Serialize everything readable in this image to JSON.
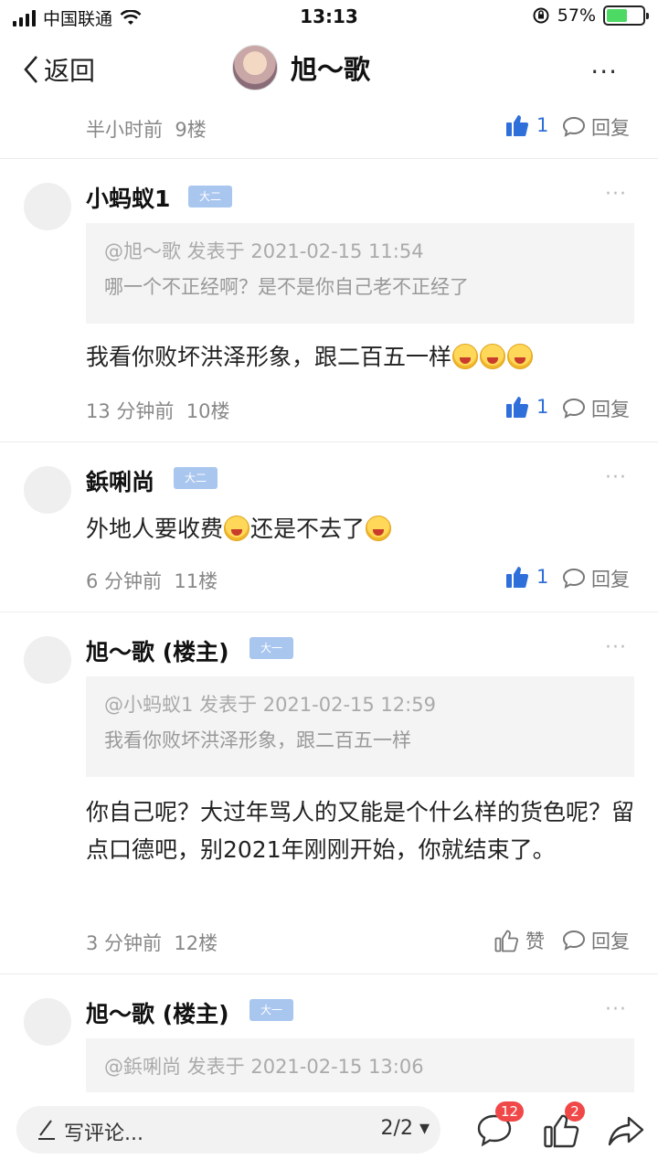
{
  "status_bar": {
    "carrier": "中国联通",
    "time": "13:13",
    "battery_percent": "57%",
    "battery_level": 0.57,
    "icons": [
      "signal-icon",
      "wifi-icon",
      "rotation-lock-icon",
      "battery-charging-icon"
    ]
  },
  "nav": {
    "back_label": "返回",
    "title": "旭～歌",
    "more_label": "···"
  },
  "top_meta": {
    "time": "半小时前",
    "floor": "9楼",
    "likes": "1",
    "reply_label": "回复"
  },
  "comments": [
    {
      "name": "小蚂蚁1",
      "badge": "大二",
      "more": "···",
      "quote_head": "@旭～歌 发表于 2021-02-15 11:54",
      "quote_body": "哪一个不正经啊？是不是你自己老不正经了",
      "text": "我看你败坏洪泽形象，跟二百五一样",
      "time": "13 分钟前",
      "floor": "10楼",
      "likes": "1",
      "reply_label": "回复"
    },
    {
      "name": "鋲唎尚",
      "badge": "大二",
      "more": "···",
      "text_a": "外地人要收费",
      "text_b": "还是不去了",
      "time": "6 分钟前",
      "floor": "11楼",
      "likes": "1",
      "reply_label": "回复"
    },
    {
      "name": "旭～歌 (楼主)",
      "badge": "大一",
      "more": "···",
      "quote_head": "@小蚂蚁1 发表于 2021-02-15 12:59",
      "quote_body": "我看你败坏洪泽形象，跟二百五一样",
      "text": "你自己呢？大过年骂人的又能是个什么样的货色呢？留点口德吧，别2021年刚刚开始，你就结束了。",
      "time": "3 分钟前",
      "floor": "12楼",
      "like_label": "赞",
      "reply_label": "回复"
    },
    {
      "name": "旭～歌 (楼主)",
      "badge": "大一",
      "more": "···",
      "quote_head": "@鋲唎尚 发表于 2021-02-15 13:06"
    }
  ],
  "bottom_bar": {
    "input_placeholder": "写评论...",
    "page_indicator": "2/2 ▾",
    "comment_count": "12",
    "like_count": "2"
  },
  "colors": {
    "like_blue": "#2e6fd9",
    "badge_blue": "#a9c6ef",
    "badge_red": "#f04848"
  }
}
